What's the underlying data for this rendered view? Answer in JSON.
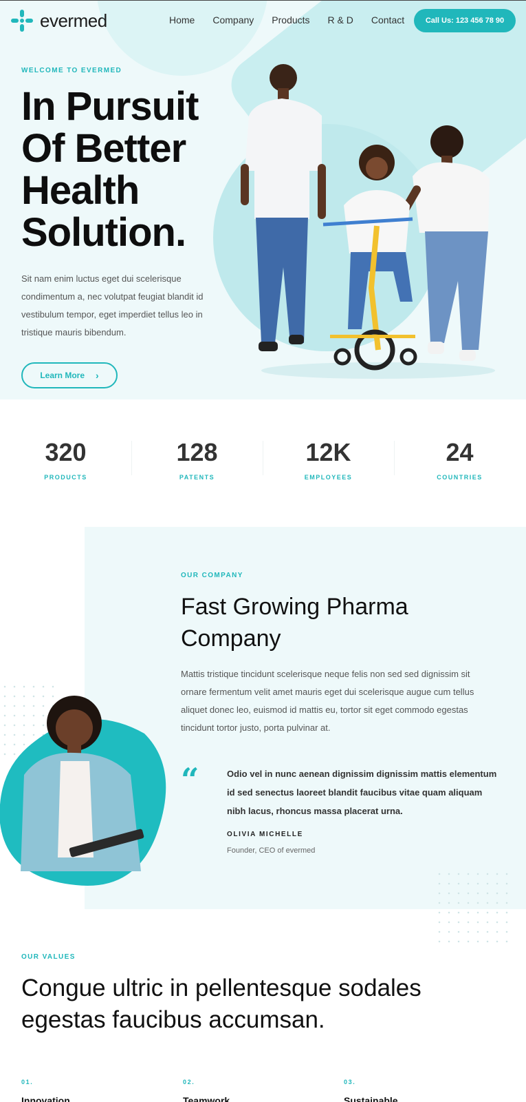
{
  "brand": {
    "name": "evermed",
    "accent_color": "#20b7bb",
    "logo_icon": "cross-plus-icon"
  },
  "nav": {
    "items": [
      "Home",
      "Company",
      "Products",
      "R & D",
      "Contact"
    ]
  },
  "call_button": {
    "label": "Call Us: 123 456 78 90"
  },
  "hero": {
    "eyebrow": "WELCOME TO EVERMED",
    "title": "In Pursuit Of Better Health Solution.",
    "text": "Sit nam enim luctus eget dui scelerisque condimentum a, nec volutpat feugiat blandit id vestibulum tempor, eget imperdiet tellus leo in tristique mauris bibendum.",
    "button_label": "Learn More",
    "button_icon": "chevron-right-icon"
  },
  "stats": [
    {
      "value": "320",
      "label": "PRODUCTS"
    },
    {
      "value": "128",
      "label": "PATENTS"
    },
    {
      "value": "12K",
      "label": "EMPLOYEES"
    },
    {
      "value": "24",
      "label": "COUNTRIES"
    }
  ],
  "company": {
    "eyebrow": "OUR COMPANY",
    "title": "Fast Growing Pharma Company",
    "text": "Mattis tristique tincidunt scelerisque neque felis non sed sed dignissim sit ornare fermentum velit amet mauris eget dui scelerisque augue cum tellus aliquet donec leo, euismod id mattis eu, tortor sit eget commodo egestas tincidunt tortor justo, porta pulvinar at.",
    "quote_icon": "quote-icon",
    "quote": "Odio vel in nunc aenean dignissim dignissim mattis elementum id sed senectus laoreet blandit faucibus vitae quam aliquam nibh lacus, rhoncus massa placerat urna.",
    "quote_author": "OLIVIA MICHELLE",
    "quote_role": "Founder, CEO of evermed"
  },
  "values": {
    "eyebrow": "OUR VALUES",
    "title": "Congue ultric in pellentesque sodales egestas faucibus accumsan.",
    "items": [
      {
        "num": "01.",
        "name": "Innovation"
      },
      {
        "num": "02.",
        "name": "Teamwork"
      },
      {
        "num": "03.",
        "name": "Sustainable"
      }
    ]
  }
}
